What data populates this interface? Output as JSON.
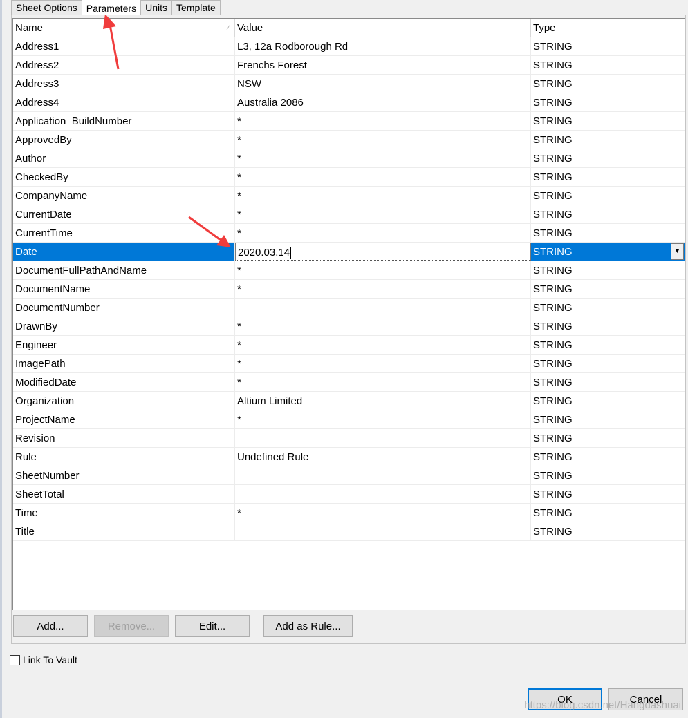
{
  "tabs": [
    {
      "label": "Sheet Options",
      "active": false
    },
    {
      "label": "Parameters",
      "active": true
    },
    {
      "label": "Units",
      "active": false
    },
    {
      "label": "Template",
      "active": false
    }
  ],
  "grid": {
    "columns": [
      "Name",
      "Value",
      "Type"
    ],
    "sort_indicator": "∕",
    "rows": [
      {
        "name": "Address1",
        "value": "L3, 12a Rodborough Rd",
        "type": "STRING"
      },
      {
        "name": "Address2",
        "value": "Frenchs Forest",
        "type": "STRING"
      },
      {
        "name": "Address3",
        "value": "NSW",
        "type": "STRING"
      },
      {
        "name": "Address4",
        "value": "Australia 2086",
        "type": "STRING"
      },
      {
        "name": "Application_BuildNumber",
        "value": "*",
        "type": "STRING"
      },
      {
        "name": "ApprovedBy",
        "value": "*",
        "type": "STRING"
      },
      {
        "name": "Author",
        "value": "*",
        "type": "STRING"
      },
      {
        "name": "CheckedBy",
        "value": "*",
        "type": "STRING"
      },
      {
        "name": "CompanyName",
        "value": "*",
        "type": "STRING"
      },
      {
        "name": "CurrentDate",
        "value": "*",
        "type": "STRING"
      },
      {
        "name": "CurrentTime",
        "value": "*",
        "type": "STRING"
      },
      {
        "name": "Date",
        "value": "2020.03.14",
        "type": "STRING",
        "selected": true
      },
      {
        "name": "DocumentFullPathAndName",
        "value": "*",
        "type": "STRING"
      },
      {
        "name": "DocumentName",
        "value": "*",
        "type": "STRING"
      },
      {
        "name": "DocumentNumber",
        "value": "",
        "type": "STRING"
      },
      {
        "name": "DrawnBy",
        "value": "*",
        "type": "STRING"
      },
      {
        "name": "Engineer",
        "value": "*",
        "type": "STRING"
      },
      {
        "name": "ImagePath",
        "value": "*",
        "type": "STRING"
      },
      {
        "name": "ModifiedDate",
        "value": "*",
        "type": "STRING"
      },
      {
        "name": "Organization",
        "value": "Altium Limited",
        "type": "STRING"
      },
      {
        "name": "ProjectName",
        "value": "*",
        "type": "STRING"
      },
      {
        "name": "Revision",
        "value": "",
        "type": "STRING"
      },
      {
        "name": "Rule",
        "value": "Undefined Rule",
        "type": "STRING"
      },
      {
        "name": "SheetNumber",
        "value": "",
        "type": "STRING"
      },
      {
        "name": "SheetTotal",
        "value": "",
        "type": "STRING"
      },
      {
        "name": "Time",
        "value": "*",
        "type": "STRING"
      },
      {
        "name": "Title",
        "value": "",
        "type": "STRING"
      }
    ]
  },
  "buttons": {
    "add": "Add...",
    "remove": "Remove...",
    "edit": "Edit...",
    "add_as_rule": "Add as Rule...",
    "ok": "OK",
    "cancel": "Cancel"
  },
  "link_to_vault": {
    "label": "Link To Vault",
    "checked": false
  },
  "watermark": "https://blog.csdn.net/Hangdashuai",
  "colors": {
    "selection": "#0078d7",
    "annotation_arrow": "#f03c3c"
  },
  "icons": {
    "dropdown": "chevron-down-icon",
    "sort": "sort-indicator-icon",
    "annotation": "red-arrow-icon"
  }
}
